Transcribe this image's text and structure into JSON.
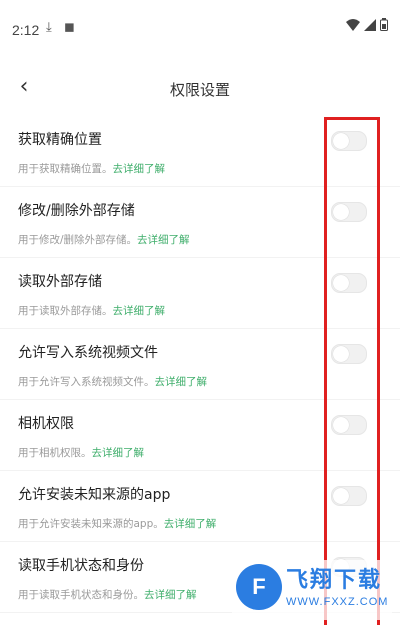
{
  "status_bar": {
    "time": "2:12",
    "icons": [
      "download-icon",
      "media-icon"
    ],
    "right_icons": [
      "wifi-icon",
      "signal-icon",
      "battery-icon"
    ]
  },
  "header": {
    "title": "权限设置",
    "back_icon": "back-chevron-icon"
  },
  "permissions": [
    {
      "title": "获取精确位置",
      "desc": "用于获取精确位置。",
      "link": "去详细了解",
      "enabled": false
    },
    {
      "title": "修改/删除外部存储",
      "desc": "用于修改/删除外部存储。",
      "link": "去详细了解",
      "enabled": false
    },
    {
      "title": "读取外部存储",
      "desc": "用于读取外部存储。",
      "link": "去详细了解",
      "enabled": false
    },
    {
      "title": "允许写入系统视频文件",
      "desc": "用于允许写入系统视频文件。",
      "link": "去详细了解",
      "enabled": false
    },
    {
      "title": "相机权限",
      "desc": "用于相机权限。",
      "link": "去详细了解",
      "enabled": false
    },
    {
      "title": "允许安装未知来源的app",
      "desc": "用于允许安装未知来源的app。",
      "link": "去详细了解",
      "enabled": false
    },
    {
      "title": "读取手机状态和身份",
      "desc": "用于读取手机状态和身份。",
      "link": "去详细了解",
      "enabled": false
    }
  ],
  "watermark": {
    "text": "飞翔下载",
    "url": "WWW.FXXZ.COM"
  },
  "colors": {
    "link": "#3fae6b",
    "highlight": "#e02020",
    "watermark": "#2b7de1"
  }
}
